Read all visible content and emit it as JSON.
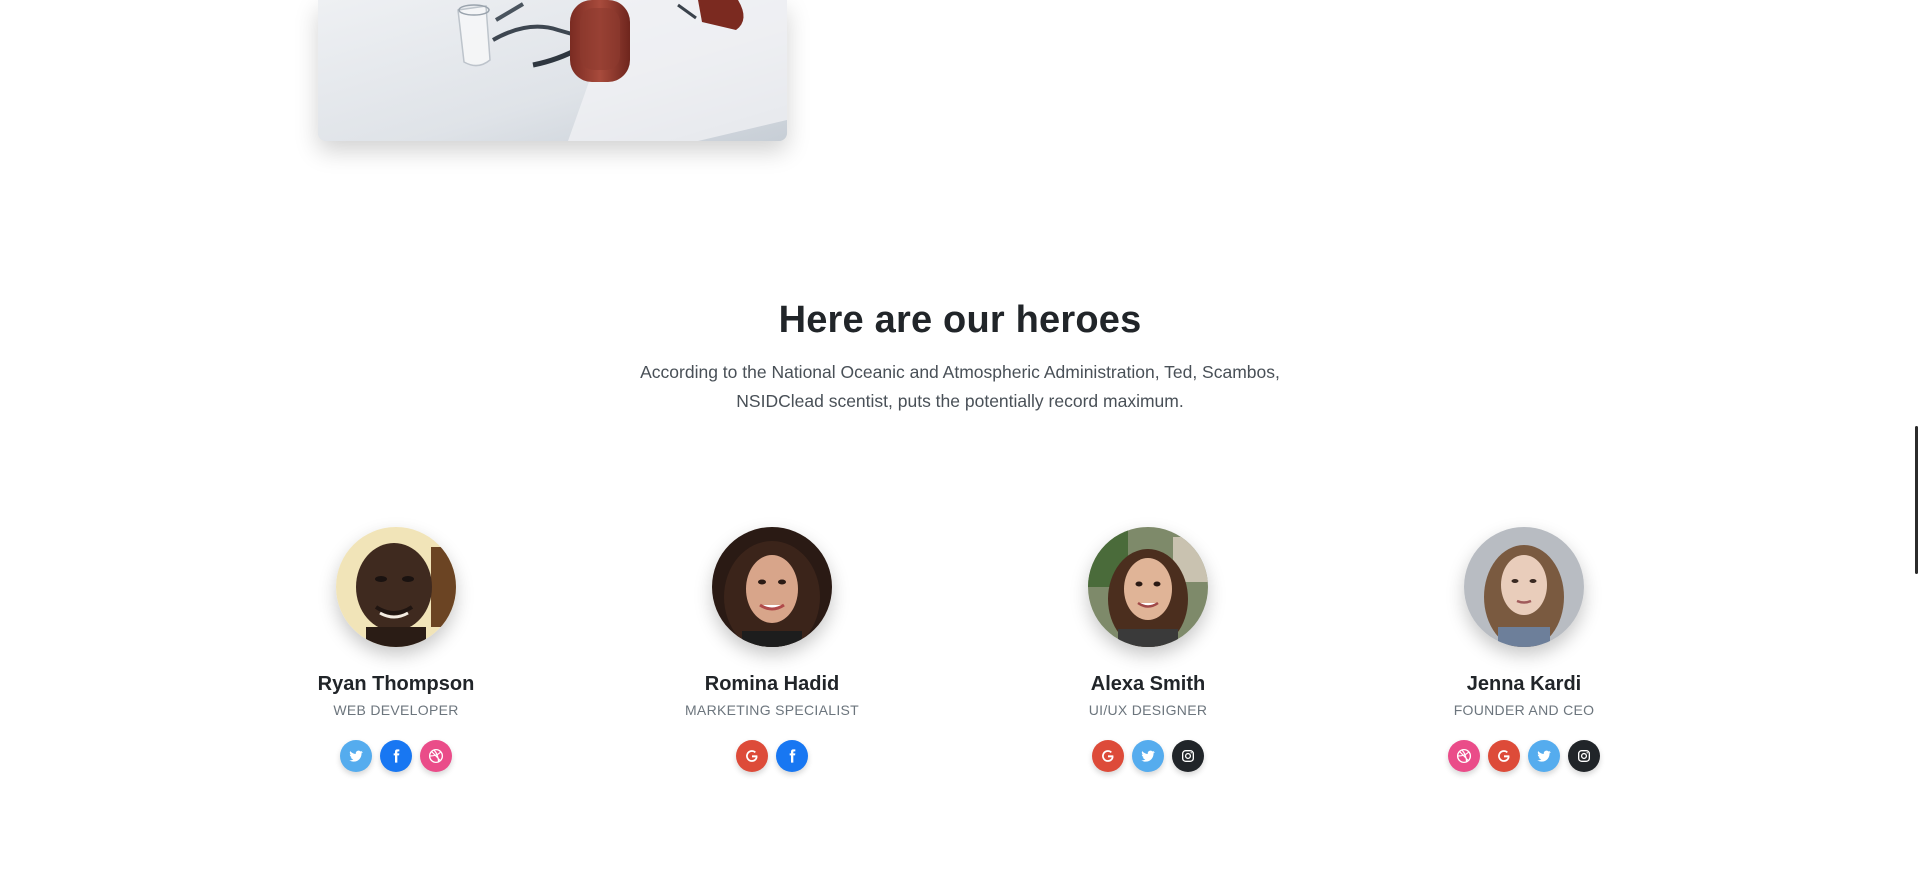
{
  "section": {
    "title": "Here are our heroes",
    "subtitle": "According to the National Oceanic and Atmospheric Administration, Ted, Scambos, NSIDClead scentist, puts the potentially record maximum."
  },
  "team": [
    {
      "name": "Ryan Thompson",
      "role": "Web Developer",
      "socials": [
        "twitter",
        "facebook",
        "dribbble"
      ]
    },
    {
      "name": "Romina Hadid",
      "role": "Marketing Specialist",
      "socials": [
        "google",
        "facebook"
      ]
    },
    {
      "name": "Alexa Smith",
      "role": "UI/UX Designer",
      "socials": [
        "google",
        "twitter",
        "instagram"
      ]
    },
    {
      "name": "Jenna Kardi",
      "role": "Founder and CEO",
      "socials": [
        "dribbble",
        "google",
        "twitter",
        "instagram"
      ]
    }
  ],
  "colors": {
    "twitter": "#55acee",
    "facebook": "#1877f2",
    "dribbble": "#ea4c89",
    "google": "#dd4b39",
    "instagram": "#212529"
  }
}
